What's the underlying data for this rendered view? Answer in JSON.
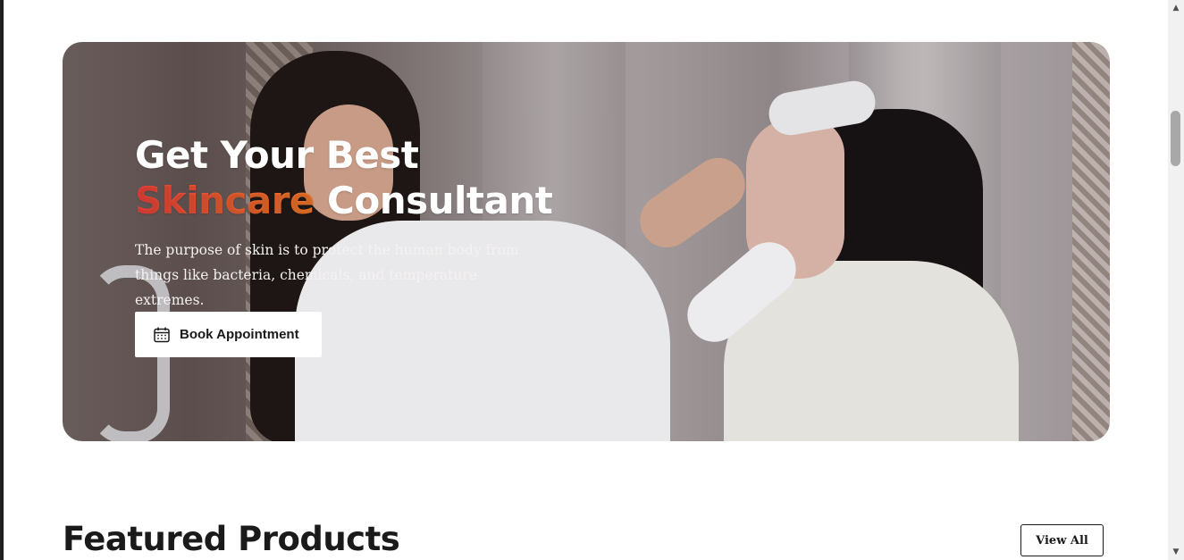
{
  "hero": {
    "title_line1": "Get Your Best",
    "title_accent": "Skincare",
    "title_line2_rest": " Consultant",
    "description": "The purpose of skin is to protect the human body from things like bacteria, chemicals, and temperature extremes.",
    "book_button_label": "Book Appointment",
    "book_button_icon": "calendar-icon",
    "accent_color": "#f25a33"
  },
  "featured": {
    "title": "Featured Products",
    "view_all_label": "View All"
  },
  "scrollbar": {
    "up_arrow": "▲",
    "down_arrow": "▼"
  }
}
